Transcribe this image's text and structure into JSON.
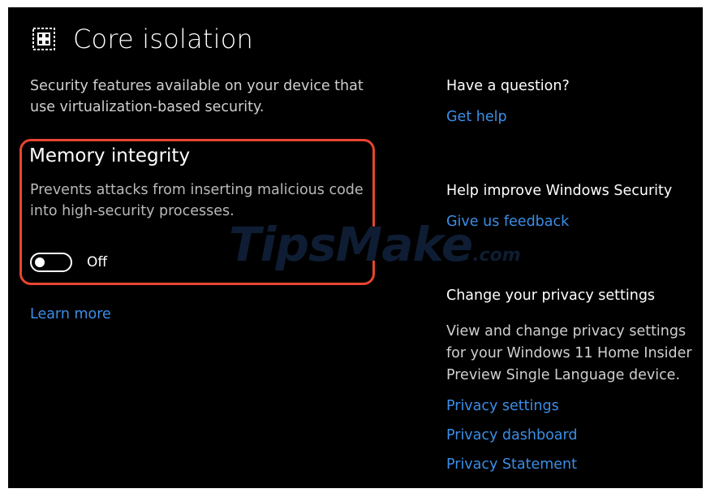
{
  "header": {
    "title": "Core isolation",
    "icon": "core-isolation-chip-icon"
  },
  "description": "Security features available on your device that use virtualization-based security.",
  "memory_integrity": {
    "title": "Memory integrity",
    "description": "Prevents attacks from inserting malicious code into high-security processes.",
    "toggle_state": "Off",
    "toggle_on": false
  },
  "learn_more": "Learn more",
  "help": {
    "heading": "Have a question?",
    "link": "Get help"
  },
  "improve": {
    "heading": "Help improve Windows Security",
    "link": "Give us feedback"
  },
  "privacy": {
    "heading": "Change your privacy settings",
    "text": "View and change privacy settings for your Windows 11 Home Insider Preview Single Language device.",
    "links": [
      "Privacy settings",
      "Privacy dashboard",
      "Privacy Statement"
    ]
  },
  "watermark": {
    "text": "TipsMake",
    "suffix": ".com"
  },
  "colors": {
    "background": "#000000",
    "link": "#3b8ee6",
    "highlight": "#e8452e"
  }
}
